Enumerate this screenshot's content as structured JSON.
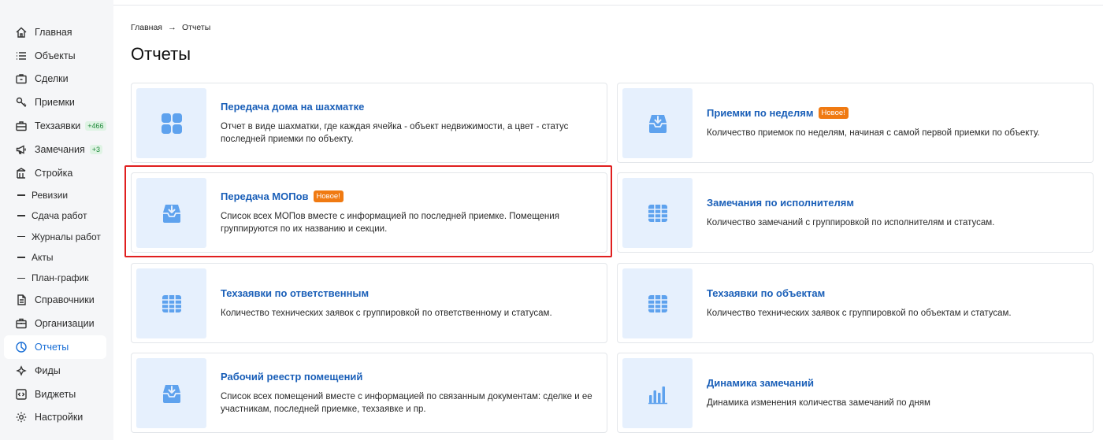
{
  "sidebar": {
    "items": [
      {
        "label": "Главная",
        "icon": "home-icon"
      },
      {
        "label": "Объекты",
        "icon": "list-icon"
      },
      {
        "label": "Сделки",
        "icon": "briefcase-icon"
      },
      {
        "label": "Приемки",
        "icon": "key-icon"
      },
      {
        "label": "Техзаявки",
        "icon": "toolbox-icon",
        "badge": "+466"
      },
      {
        "label": "Замечания",
        "icon": "megaphone-icon",
        "badge": "+3"
      },
      {
        "label": "Стройка",
        "icon": "crane-icon"
      }
    ],
    "sub_items": [
      "Ревизии",
      "Сдача работ",
      "Журналы работ",
      "Акты",
      "План-график"
    ],
    "bottom_items": [
      {
        "label": "Справочники",
        "icon": "document-icon"
      },
      {
        "label": "Организации",
        "icon": "building-icon"
      },
      {
        "label": "Отчеты",
        "icon": "pie-chart-icon",
        "active": true
      },
      {
        "label": "Фиды",
        "icon": "feed-icon"
      },
      {
        "label": "Виджеты",
        "icon": "code-icon"
      },
      {
        "label": "Настройки",
        "icon": "gear-icon"
      }
    ]
  },
  "breadcrumb": {
    "home": "Главная",
    "current": "Отчеты"
  },
  "page_title": "Отчеты",
  "cards": [
    {
      "title": "Передача дома на шахматке",
      "desc": "Отчет в виде шахматки, где каждая ячейка - объект недвижимости, а цвет - статус последней приемки по объекту.",
      "icon": "grid-icon",
      "badge": ""
    },
    {
      "title": "Приемки по неделям",
      "desc": "Количество приемок по неделям, начиная с самой первой приемки по объекту.",
      "icon": "inbox-icon",
      "badge": "Новое!"
    },
    {
      "title": "Передача МОПов",
      "desc": "Список всех МОПов вместе с информацией по последней приемке. Помещения группируются по их названию и секции.",
      "icon": "inbox-icon",
      "badge": "Новое!"
    },
    {
      "title": "Замечания по исполнителям",
      "desc": "Количество замечаний с группировкой по исполнителям и статусам.",
      "icon": "table-icon",
      "badge": ""
    },
    {
      "title": "Техзаявки по ответственным",
      "desc": "Количество технических заявок с группировкой по ответственному и статусам.",
      "icon": "table-icon",
      "badge": ""
    },
    {
      "title": "Техзаявки по объектам",
      "desc": "Количество технических заявок с группировкой по объектам и статусам.",
      "icon": "table-icon",
      "badge": ""
    },
    {
      "title": "Рабочий реестр помещений",
      "desc": "Список всех помещений вместе с информацией по связанным документам: сделке и ее участникам, последней приемке, техзаявке и пр.",
      "icon": "inbox-icon",
      "badge": ""
    },
    {
      "title": "Динамика замечаний",
      "desc": "Динамика изменения количества замечаний по дням",
      "icon": "bar-chart-icon",
      "badge": ""
    }
  ],
  "colors": {
    "accent": "#1a6fd6",
    "badge": "#f07a12",
    "highlight": "#e01f1f",
    "icon_fill": "#5ea2ee",
    "thumb_bg": "#e6f0fd"
  }
}
